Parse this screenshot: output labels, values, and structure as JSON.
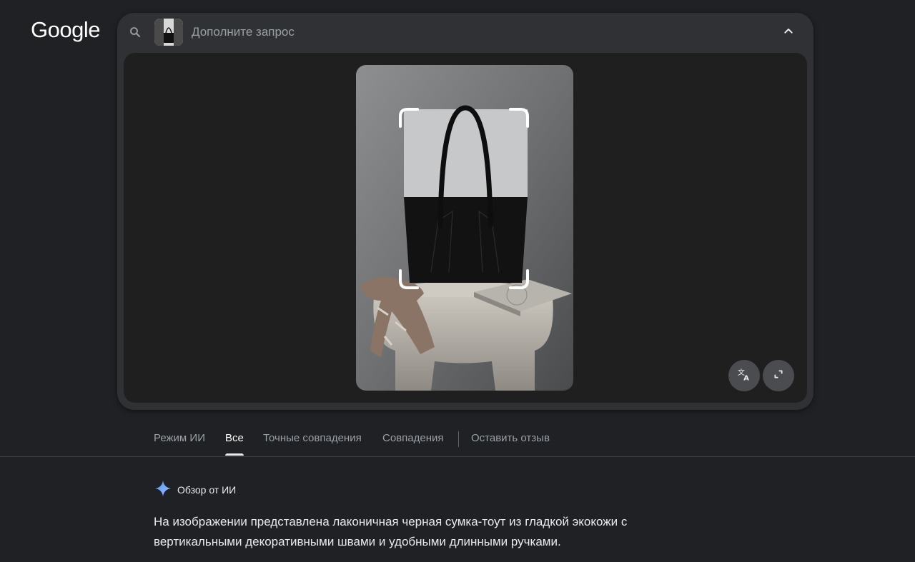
{
  "header": {
    "logo_text": "Google"
  },
  "search": {
    "placeholder": "Дополните запрос",
    "icon": "search-icon",
    "collapse_icon": "chevron-up-icon"
  },
  "viewer": {
    "buttons": [
      {
        "icon": "translate-icon"
      },
      {
        "icon": "fullscreen-icon"
      }
    ]
  },
  "tabs": [
    {
      "label": "Режим ИИ",
      "active": false
    },
    {
      "label": "Все",
      "active": true
    },
    {
      "label": "Точные совпадения",
      "active": false
    },
    {
      "label": "Совпадения",
      "active": false
    },
    {
      "label": "Оставить отзыв",
      "active": false
    }
  ],
  "ai_overview": {
    "title": "Обзор от ИИ",
    "text": "На изображении представлена лаконичная черная сумка-тоут из гладкой экокожи с вертикальными декоративными швами и удобными длинными ручками."
  },
  "colors": {
    "background": "#202124",
    "card": "#303134",
    "accent": "#8ab4f8"
  }
}
